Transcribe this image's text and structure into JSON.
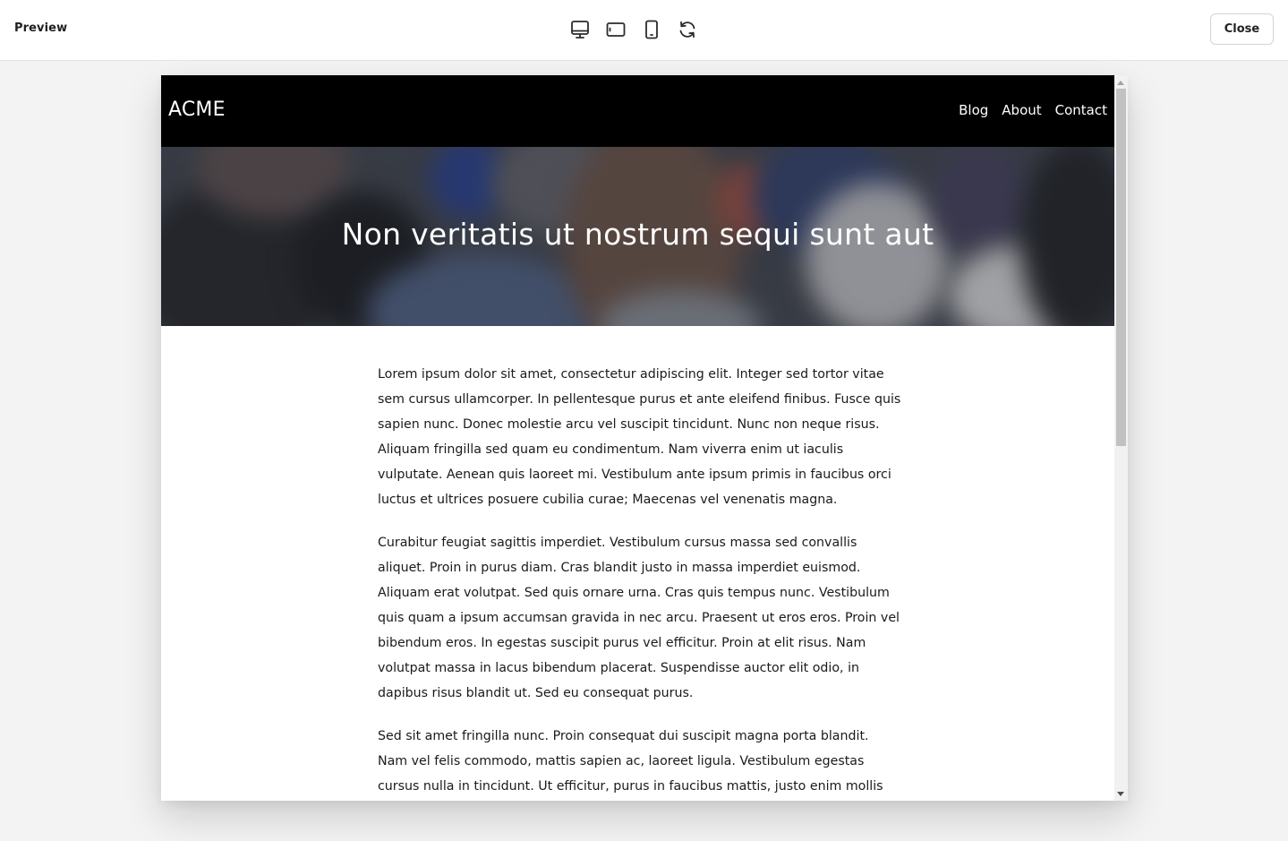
{
  "toolbar": {
    "title": "Preview",
    "devices": [
      {
        "name": "desktop-view",
        "icon": "monitor-icon"
      },
      {
        "name": "tablet-view",
        "icon": "tablet-landscape-icon"
      },
      {
        "name": "mobile-view",
        "icon": "phone-icon"
      },
      {
        "name": "rotate-view",
        "icon": "rotate-icon"
      }
    ],
    "close_label": "Close"
  },
  "site": {
    "logo": "ACME",
    "nav": [
      "Blog",
      "About",
      "Contact"
    ],
    "hero_title": "Non veritatis ut nostrum sequi sunt aut",
    "paragraphs": [
      "Lorem ipsum dolor sit amet, consectetur adipiscing elit. Integer sed tortor vitae sem cursus ullamcorper. In pellentesque purus et ante eleifend finibus. Fusce quis sapien nunc. Donec molestie arcu vel suscipit tincidunt. Nunc non neque risus. Aliquam fringilla sed quam eu condimentum. Nam viverra enim ut iaculis vulputate. Aenean quis laoreet mi. Vestibulum ante ipsum primis in faucibus orci luctus et ultrices posuere cubilia curae; Maecenas vel venenatis magna.",
      "Curabitur feugiat sagittis imperdiet. Vestibulum cursus massa sed convallis aliquet. Proin in purus diam. Cras blandit justo in massa imperdiet euismod. Aliquam erat volutpat. Sed quis ornare urna. Cras quis tempus nunc. Vestibulum quis quam a ipsum accumsan gravida in nec arcu. Praesent ut eros eros. Proin vel bibendum eros. In egestas suscipit purus vel efficitur. Proin at elit risus. Nam volutpat massa in lacus bibendum placerat. Suspendisse auctor elit odio, in dapibus risus blandit ut. Sed eu consequat purus.",
      "Sed sit amet fringilla nunc. Proin consequat dui suscipit magna porta blandit. Nam vel felis commodo, mattis sapien ac, laoreet ligula. Vestibulum egestas cursus nulla in tincidunt. Ut efficitur, purus in faucibus mattis, justo enim mollis"
    ]
  },
  "colors": {
    "nav_background": "#000000",
    "page_background": "#f3f3f3",
    "text": "#1a1a1a"
  }
}
